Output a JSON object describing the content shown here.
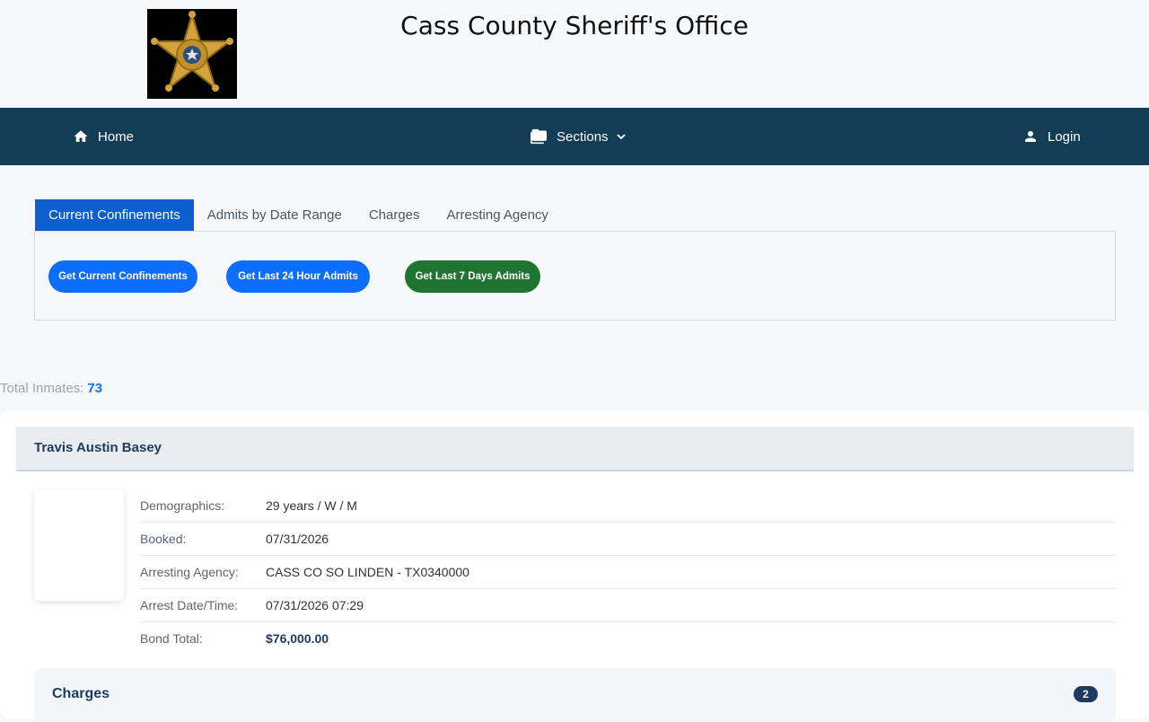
{
  "header": {
    "title": "Cass County Sheriff's Office",
    "logo_icon": "sheriff-star-badge"
  },
  "nav": {
    "home": {
      "label": "Home",
      "icon": "home-icon"
    },
    "sections": {
      "label": "Sections",
      "icon": "folder-icon"
    },
    "login": {
      "label": "Login",
      "icon": "user-icon"
    }
  },
  "tabs": [
    {
      "label": "Current Confinements",
      "active": true
    },
    {
      "label": "Admits by Date Range",
      "active": false
    },
    {
      "label": "Charges",
      "active": false
    },
    {
      "label": "Arresting Agency",
      "active": false
    }
  ],
  "buttons": {
    "current": "Get Current Confinements",
    "last24": "Get Last 24 Hour Admits",
    "last7": "Get Last 7 Days Admits"
  },
  "summary": {
    "label": "Total Inmates:",
    "count": "73"
  },
  "inmate": {
    "name": "Travis Austin Basey",
    "fields": [
      {
        "label": "Demographics:",
        "value": "29 years / W / M"
      },
      {
        "label": "Booked:",
        "value": "07/31/2026"
      },
      {
        "label": "Arresting Agency:",
        "value": "CASS CO SO LINDEN - TX0340000"
      },
      {
        "label": "Arrest Date/Time:",
        "value": "07/31/2026 07:29"
      },
      {
        "label": "Bond Total:",
        "value": "$76,000.00"
      }
    ],
    "charges_label": "Charges",
    "charges_count": "2"
  },
  "colors": {
    "nav_bg": "#123d54",
    "primary": "#0d6efd",
    "success": "#1e7430",
    "accent": "#1f3a5f"
  }
}
